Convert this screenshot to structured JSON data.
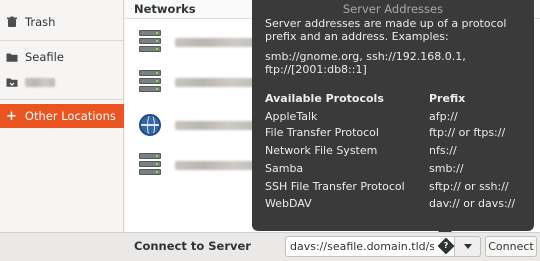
{
  "sidebar": {
    "items": [
      {
        "label": "Trash",
        "icon": "trash-icon"
      },
      {
        "label": "Seafile",
        "icon": "folder-icon"
      },
      {
        "label": "",
        "icon": "drive-icon"
      },
      {
        "label": "Other Locations",
        "icon": "plus-icon"
      }
    ],
    "active_color": "#e95420"
  },
  "main": {
    "section_header": "Networks",
    "rows": [
      {
        "icon": "server-icon"
      },
      {
        "icon": "server-icon"
      },
      {
        "icon": "globe-icon"
      },
      {
        "icon": "server-icon"
      }
    ]
  },
  "popover": {
    "title": "Server Addresses",
    "description": "Server addresses are made up of a protocol prefix and an address. Examples:",
    "examples": "smb://gnome.org, ssh://192.168.0.1, ftp://[2001:db8::1]",
    "col_protocols": "Available Protocols",
    "col_prefix": "Prefix",
    "protocols": [
      {
        "name": "AppleTalk",
        "prefix": "afp://"
      },
      {
        "name": "File Transfer Protocol",
        "prefix": "ftp:// or ftps://"
      },
      {
        "name": "Network File System",
        "prefix": "nfs://"
      },
      {
        "name": "Samba",
        "prefix": "smb://"
      },
      {
        "name": "SSH File Transfer Protocol",
        "prefix": "sftp:// or ssh://"
      },
      {
        "name": "WebDAV",
        "prefix": "dav:// or davs://"
      }
    ]
  },
  "bottom": {
    "label": "Connect to Server",
    "address_value": "davs://seafile.domain.tld/se",
    "connect_label": "Connect"
  }
}
